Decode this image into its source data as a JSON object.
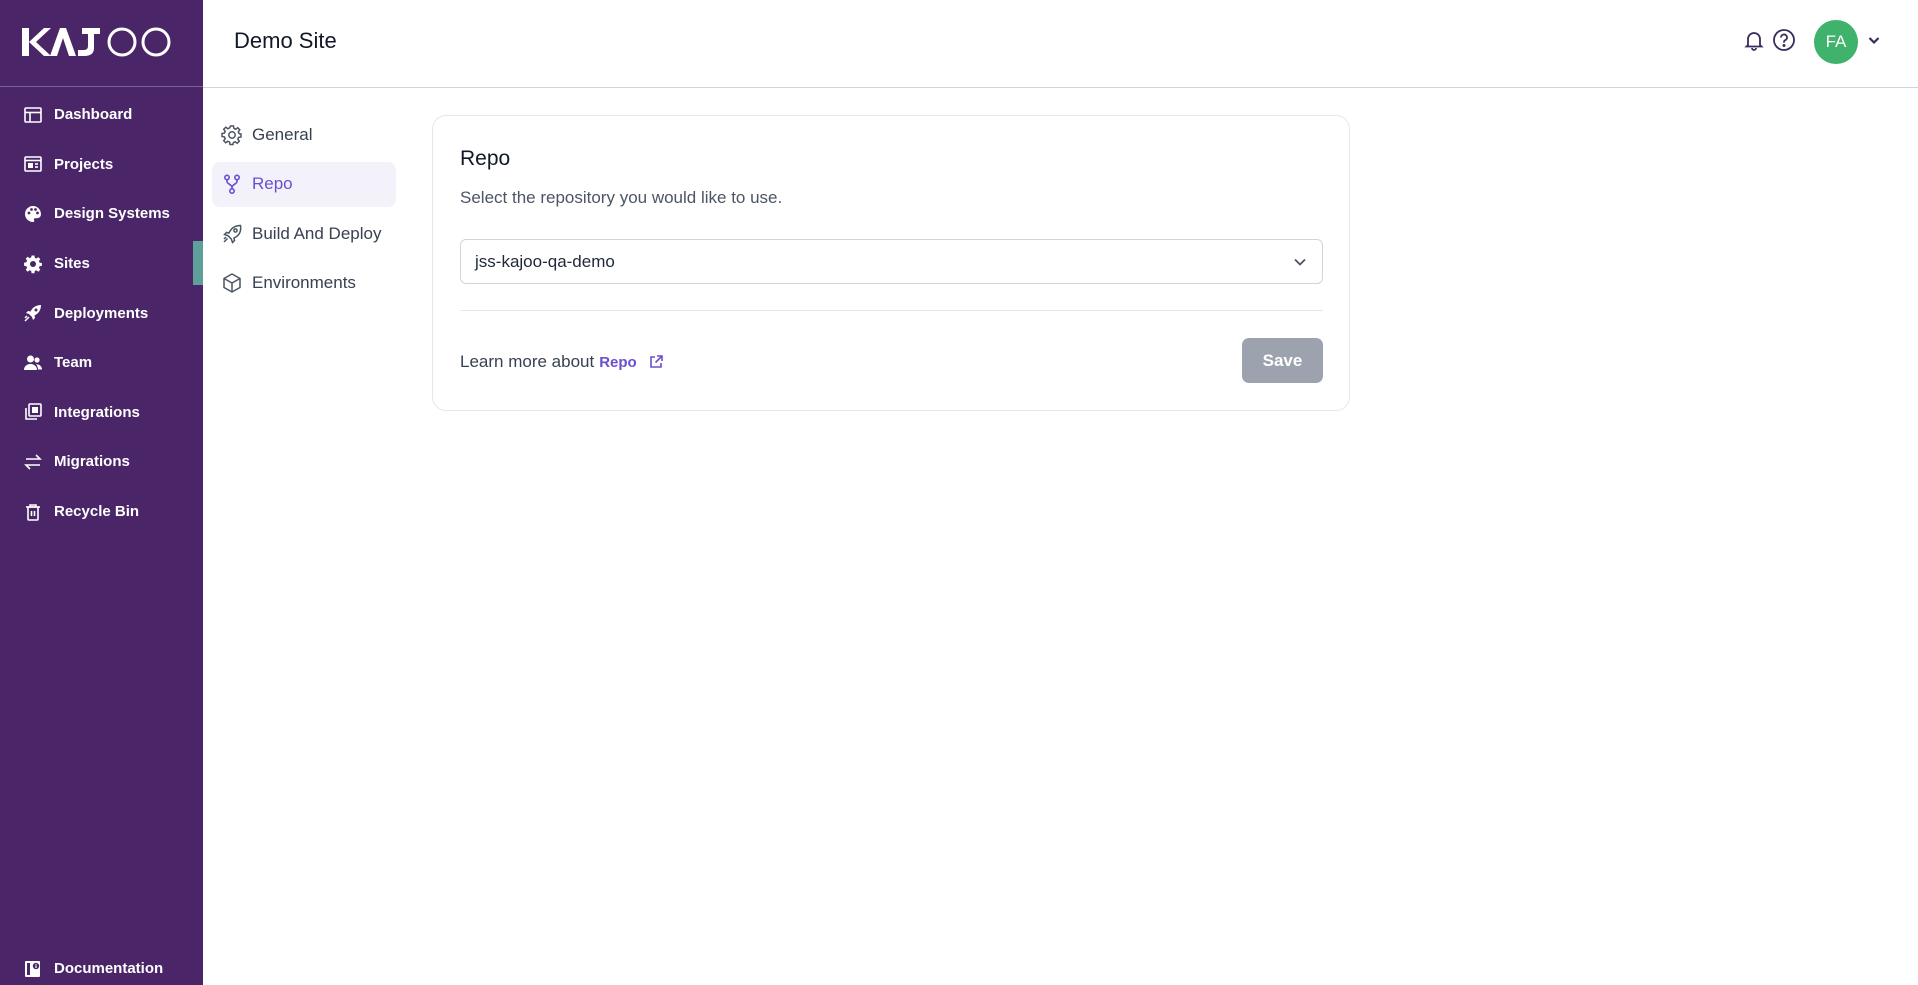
{
  "app": {
    "logo_text": "KAJOO",
    "page_title": "Demo Site"
  },
  "sidebar": {
    "items": [
      {
        "label": "Dashboard",
        "icon": "table-layout-icon"
      },
      {
        "label": "Projects",
        "icon": "browser-window-icon"
      },
      {
        "label": "Design Systems",
        "icon": "palette-icon"
      },
      {
        "label": "Sites",
        "icon": "gear-icon",
        "active": true
      },
      {
        "label": "Deployments",
        "icon": "rocket-icon"
      },
      {
        "label": "Team",
        "icon": "users-icon"
      },
      {
        "label": "Integrations",
        "icon": "stacked-squares-icon"
      },
      {
        "label": "Migrations",
        "icon": "arrows-exchange-icon"
      },
      {
        "label": "Recycle Bin",
        "icon": "trash-icon"
      }
    ],
    "documentation": {
      "label": "Documentation",
      "icon": "book-info-icon"
    },
    "active_indicator_color": "#5f9f9a",
    "background_color": "#4a2669"
  },
  "header": {
    "notifications_icon": "bell-icon",
    "help_icon": "question-circle-icon",
    "avatar_initials": "FA",
    "avatar_color": "#3fb36b",
    "menu_icon": "chevron-down-icon"
  },
  "settings_nav": {
    "items": [
      {
        "label": "General",
        "icon": "gear-icon"
      },
      {
        "label": "Repo",
        "icon": "git-branch-icon",
        "active": true
      },
      {
        "label": "Build And Deploy",
        "icon": "rocket-icon"
      },
      {
        "label": "Environments",
        "icon": "cube-icon"
      }
    ],
    "accent_color": "#6b4fd0"
  },
  "repo_card": {
    "title": "Repo",
    "description": "Select the repository you would like to use.",
    "selected_repo": "jss-kajoo-qa-demo",
    "learn_more_text": "Learn more about",
    "learn_more_link": "Repo",
    "save_label": "Save",
    "save_button_color": "#9ca3af"
  }
}
